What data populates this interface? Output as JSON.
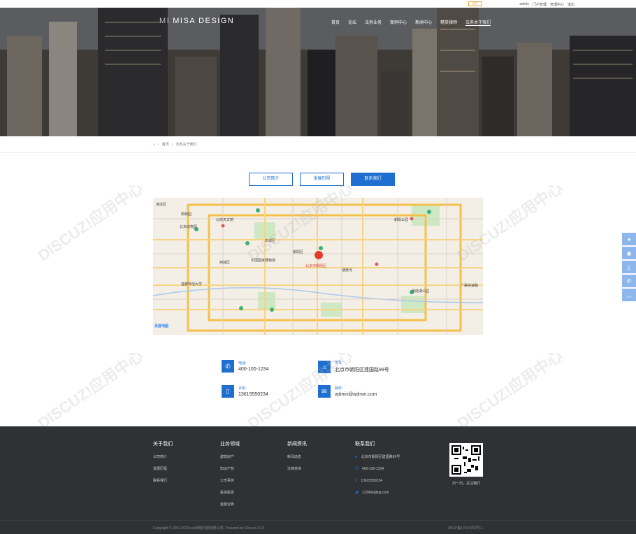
{
  "topbar": {
    "user": "admin",
    "links": [
      "门户管理",
      "管理中心",
      "退出"
    ],
    "diy": "DIY"
  },
  "header": {
    "logo_mark": "MI",
    "logo_text": "MISA DESIGN",
    "nav": [
      "首页",
      "论坛",
      "法务业务",
      "案例中心",
      "新闻中心",
      "精英律师",
      "法务关于我们"
    ],
    "active_nav": "法务关于我们"
  },
  "breadcrumb": {
    "home_icon": "home-icon",
    "items": [
      "首页",
      "法务关于我们"
    ]
  },
  "tabs": [
    "公司简介",
    "发展历程",
    "联系我们"
  ],
  "active_tab": "联系我们",
  "map": {
    "labels": [
      "海淀区",
      "东城区",
      "朝阳区",
      "西城区",
      "北京天文馆",
      "北京动物园",
      "颐和园",
      "北京市朝阳区",
      "中国国家博物馆",
      "首都师范大学",
      "广渠快速路",
      "通惠河",
      "百度地图",
      "朝阳公园",
      "团结湖公园"
    ]
  },
  "contact": {
    "phone_label": "电话:",
    "phone": "400-100-1234",
    "address_label": "地址:",
    "address": "北京市朝阳区建国路99号",
    "mobile_label": "手机:",
    "mobile": "13615550234",
    "email_label": "邮件:",
    "email": "admin@admin.com"
  },
  "footer": {
    "col1": {
      "title": "关于我们",
      "items": [
        "公司简介",
        "发展历程",
        "联系我们"
      ]
    },
    "col2": {
      "title": "业务领域",
      "items": [
        "建筑房产",
        "知识产权",
        "公司事务",
        "投资股票",
        "金融证券"
      ]
    },
    "col3": {
      "title": "新闻资讯",
      "items": [
        "新闻动态",
        "法律咨询"
      ]
    },
    "col4": {
      "title": "联系我们",
      "items": [
        "北京市朝阳区建国路99号",
        "400-100-1234",
        "13615550234",
        "123456@qq.com"
      ]
    },
    "qr_caption": "扫一扫，关注我们",
    "copyright": "Copyright © 2001-2020 xxx网络科技有限公司. Powered by Discuz! X3.5",
    "icp": "京ICP备17014762号-1"
  },
  "watermark": "DISCUZ!应用中心 | 贰道 addon.dismall.com"
}
